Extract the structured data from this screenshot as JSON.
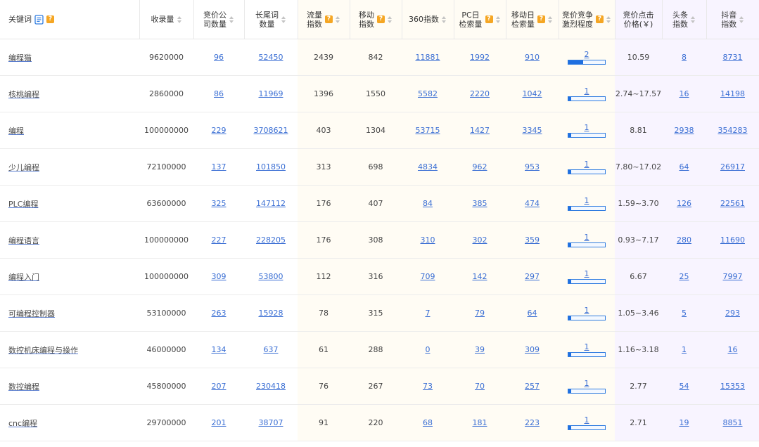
{
  "columns": {
    "keyword": "关键词",
    "index_count": "收录量",
    "bid_companies": [
      "竞价公",
      "司数量"
    ],
    "longtail": [
      "长尾词",
      "数量"
    ],
    "traffic": [
      "流量",
      "指数"
    ],
    "mobile": [
      "移动",
      "指数"
    ],
    "index360": "360指数",
    "pc_daily": [
      "PC日",
      "检索量"
    ],
    "mobile_daily": [
      "移动日",
      "检索量"
    ],
    "competition": [
      "竞价竞争",
      "激烈程度"
    ],
    "cpc": [
      "竞价点击",
      "价格(￥)"
    ],
    "toutiao": [
      "头条",
      "指数"
    ],
    "douyin": [
      "抖音",
      "指数"
    ]
  },
  "help_glyph": "?",
  "accent_colors": {
    "link": "#3b6fd4",
    "help_badge": "#f5a623",
    "bar": "#1f6fe0"
  },
  "rows": [
    {
      "keyword": "编程猫",
      "index_count": "9620000",
      "bid_companies": "96",
      "longtail": "52450",
      "traffic": "2439",
      "mobile": "842",
      "index360": "11881",
      "pc_daily": "1992",
      "mobile_daily": "910",
      "competition": "2",
      "competition_level": 0.4,
      "cpc": "10.59",
      "toutiao": "8",
      "douyin": "8731"
    },
    {
      "keyword": "核桃编程",
      "index_count": "2860000",
      "bid_companies": "86",
      "longtail": "11969",
      "traffic": "1396",
      "mobile": "1550",
      "index360": "5582",
      "pc_daily": "2220",
      "mobile_daily": "1042",
      "competition": "1",
      "competition_level": 0.08,
      "cpc": "2.74~17.57",
      "toutiao": "16",
      "douyin": "14198"
    },
    {
      "keyword": "编程",
      "index_count": "100000000",
      "bid_companies": "229",
      "longtail": "3708621",
      "traffic": "403",
      "mobile": "1304",
      "index360": "53715",
      "pc_daily": "1427",
      "mobile_daily": "3345",
      "competition": "1",
      "competition_level": 0.08,
      "cpc": "8.81",
      "toutiao": "2938",
      "douyin": "354283"
    },
    {
      "keyword": "少儿编程",
      "index_count": "72100000",
      "bid_companies": "137",
      "longtail": "101850",
      "traffic": "313",
      "mobile": "698",
      "index360": "4834",
      "pc_daily": "962",
      "mobile_daily": "953",
      "competition": "1",
      "competition_level": 0.08,
      "cpc": "7.80~17.02",
      "toutiao": "64",
      "douyin": "26917"
    },
    {
      "keyword": "PLC编程",
      "index_count": "63600000",
      "bid_companies": "325",
      "longtail": "147112",
      "traffic": "176",
      "mobile": "407",
      "index360": "84",
      "pc_daily": "385",
      "mobile_daily": "474",
      "competition": "1",
      "competition_level": 0.08,
      "cpc": "1.59~3.70",
      "toutiao": "126",
      "douyin": "22561"
    },
    {
      "keyword": "编程语言",
      "index_count": "100000000",
      "bid_companies": "227",
      "longtail": "228205",
      "traffic": "176",
      "mobile": "308",
      "index360": "310",
      "pc_daily": "302",
      "mobile_daily": "359",
      "competition": "1",
      "competition_level": 0.08,
      "cpc": "0.93~7.17",
      "toutiao": "280",
      "douyin": "11690"
    },
    {
      "keyword": "编程入门",
      "index_count": "100000000",
      "bid_companies": "309",
      "longtail": "53800",
      "traffic": "112",
      "mobile": "316",
      "index360": "709",
      "pc_daily": "142",
      "mobile_daily": "297",
      "competition": "1",
      "competition_level": 0.08,
      "cpc": "6.67",
      "toutiao": "25",
      "douyin": "7997"
    },
    {
      "keyword": "可编程控制器",
      "index_count": "53100000",
      "bid_companies": "263",
      "longtail": "15928",
      "traffic": "78",
      "mobile": "315",
      "index360": "7",
      "pc_daily": "79",
      "mobile_daily": "64",
      "competition": "1",
      "competition_level": 0.08,
      "cpc": "1.05~3.46",
      "toutiao": "5",
      "douyin": "293"
    },
    {
      "keyword": "数控机床编程与操作",
      "index_count": "46000000",
      "bid_companies": "134",
      "longtail": "637",
      "traffic": "61",
      "mobile": "288",
      "index360": "0",
      "pc_daily": "39",
      "mobile_daily": "309",
      "competition": "1",
      "competition_level": 0.08,
      "cpc": "1.16~3.18",
      "toutiao": "1",
      "douyin": "16"
    },
    {
      "keyword": "数控编程",
      "index_count": "45800000",
      "bid_companies": "207",
      "longtail": "230418",
      "traffic": "76",
      "mobile": "267",
      "index360": "73",
      "pc_daily": "70",
      "mobile_daily": "257",
      "competition": "1",
      "competition_level": 0.08,
      "cpc": "2.77",
      "toutiao": "54",
      "douyin": "15353"
    },
    {
      "keyword": "cnc编程",
      "index_count": "29700000",
      "bid_companies": "201",
      "longtail": "38707",
      "traffic": "91",
      "mobile": "220",
      "index360": "68",
      "pc_daily": "181",
      "mobile_daily": "223",
      "competition": "1",
      "competition_level": 0.08,
      "cpc": "2.71",
      "toutiao": "19",
      "douyin": "8851"
    }
  ]
}
